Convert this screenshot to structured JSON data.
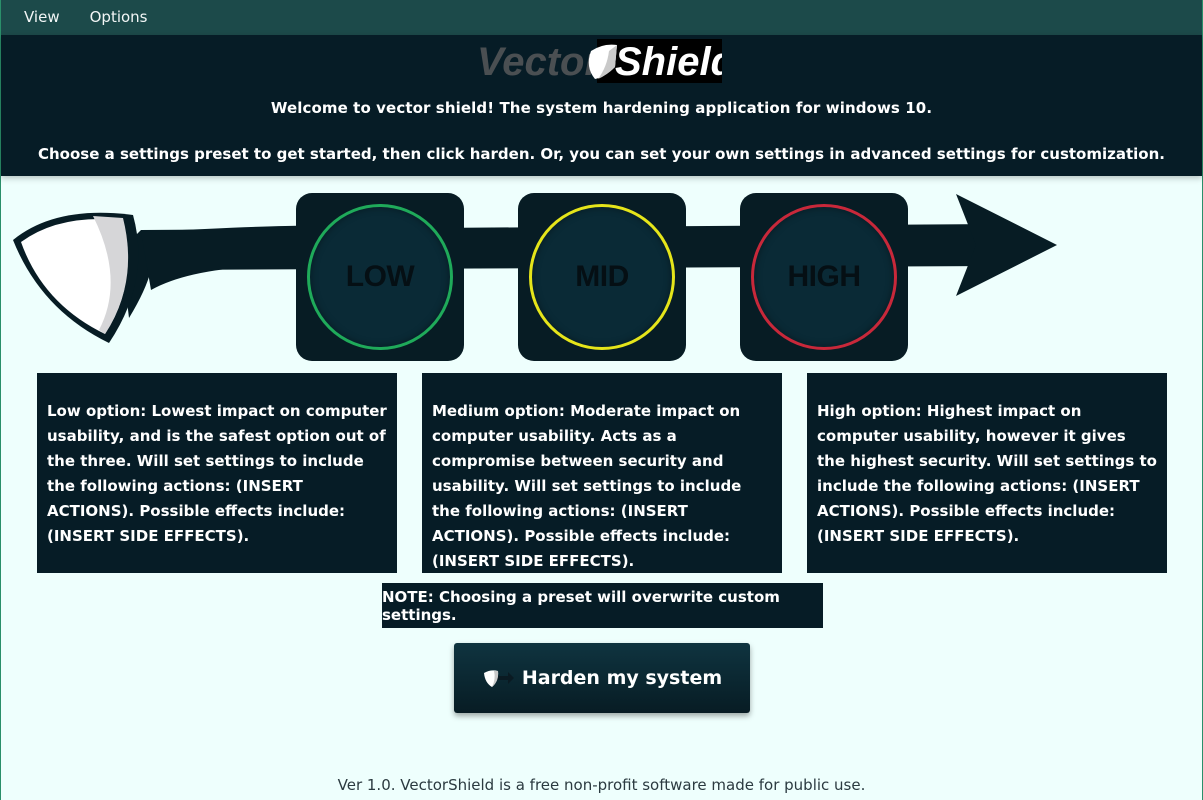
{
  "menu": {
    "items": [
      {
        "label": "View"
      },
      {
        "label": "Options"
      }
    ]
  },
  "header": {
    "logo_left": "Vector",
    "logo_right": "Shield",
    "welcome": "Welcome to vector shield! The system hardening application for windows 10.",
    "instructions": "Choose a settings preset to get started, then click harden. Or, you can set your own settings in advanced settings for customization."
  },
  "presets": [
    {
      "label": "LOW",
      "ring_color": "#1faa5a"
    },
    {
      "label": "MID",
      "ring_color": "#e5e51a"
    },
    {
      "label": "HIGH",
      "ring_color": "#c8283a"
    }
  ],
  "descriptions": [
    "Low option: Lowest impact on computer usability, and is the safest option out of the three. Will set settings to include the following actions: (INSERT ACTIONS). Possible effects include: (INSERT SIDE EFFECTS).",
    "Medium option: Moderate impact on computer usability. Acts as a compromise between security and usability. Will set settings to include the following actions: (INSERT ACTIONS). Possible effects include: (INSERT SIDE EFFECTS).",
    "High option: Highest impact on computer usability, however it gives the highest security. Will set settings to include the following actions: (INSERT ACTIONS). Possible effects include: (INSERT SIDE EFFECTS)."
  ],
  "note": "NOTE: Choosing a preset will overwrite custom settings.",
  "harden_button": {
    "label": "Harden my system",
    "icon": "shield-arrow-icon"
  },
  "footer": "Ver 1.0. VectorShield is a free non-profit software made for public use.",
  "colors": {
    "dark": "#061c26",
    "menubar": "#1c4a4a",
    "background": "#eefffd"
  }
}
